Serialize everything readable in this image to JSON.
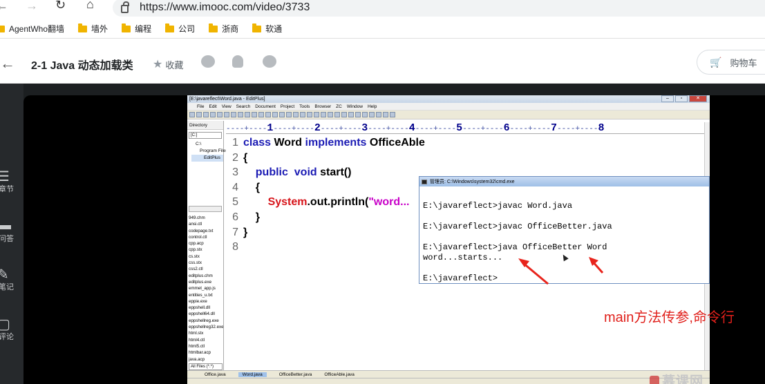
{
  "browser": {
    "url": "https://www.imooc.com/video/3733",
    "bookmarks": [
      "AgentWho翻墙",
      "墙外",
      "编程",
      "公司",
      "浙商",
      "软通"
    ]
  },
  "site": {
    "title": "2-1 Java 动态加载类",
    "favorite_label": "收藏",
    "cart_label": "购物车",
    "rail": [
      {
        "label": "章节",
        "icon": "list-icon"
      },
      {
        "label": "问答",
        "icon": "chat-icon"
      },
      {
        "label": "笔记",
        "icon": "pen-icon"
      },
      {
        "label": "评论",
        "icon": "comment-icon"
      }
    ]
  },
  "editplus": {
    "title": "[E:\\javareflect\\Word.java - EditPlus]",
    "menu": [
      "File",
      "Edit",
      "View",
      "Search",
      "Document",
      "Project",
      "Tools",
      "Browser",
      "ZC",
      "Window",
      "Help"
    ],
    "directory_tab": "Directory",
    "drive": "[C:]",
    "tree": [
      "C:\\",
      "Program Files",
      "EditPlus"
    ],
    "files": [
      "949.chm",
      "ansi.ctl",
      "codepage.txt",
      "control.ctl",
      "cpp.acp",
      "cpp.stx",
      "cs.stx",
      "css.stx",
      "css2.ctl",
      "editplus.chm",
      "editplus.exe",
      "emmet_app.js",
      "entities_u.txt",
      "eppie.exe",
      "eppshell.dll",
      "eppshell64.dll",
      "eppshellreg.exe",
      "eppshellreg32.exe",
      "html.stx",
      "html4.ctl",
      "html5.ctl",
      "htmlbar.acp",
      "java.acp"
    ],
    "all_files": "All Files (*.*)",
    "ruler": "----+----1----+----2----+----3----+----4----+----5----+----6----+----7----+----8",
    "line_numbers": [
      "1",
      "2",
      "3",
      "4",
      "5",
      "6",
      "7",
      "8"
    ],
    "tabs": [
      "Office.java",
      "Word.java",
      "OfficeBetter.java",
      "OfficeAble.java"
    ],
    "code": {
      "l1_a": "class ",
      "l1_b": "Word ",
      "l1_c": "implements ",
      "l1_d": "OfficeAble",
      "l2": "{",
      "l3_a": "    public  void ",
      "l3_b": "start()",
      "l4": "    {",
      "l5_a": "        ",
      "l5_b": "System",
      "l5_c": ".out.println(",
      "l5_d": "\"word...",
      "l6": "    }",
      "l7": "}"
    }
  },
  "cmd": {
    "title": "管理员: C:\\Windows\\system32\\cmd.exe",
    "lines": [
      "",
      "E:\\javareflect>javac Word.java",
      "",
      "E:\\javareflect>javac OfficeBetter.java",
      "",
      "E:\\javareflect>java OfficeBetter Word",
      "word...starts...",
      "",
      "E:\\javareflect>"
    ]
  },
  "annotation": "main方法传参,命令行",
  "watermark": "慕课网",
  "colors": {
    "annotation": "#e0201b",
    "keyword": "#1b1bb4",
    "system": "#d7141a",
    "string": "#c800c8"
  }
}
